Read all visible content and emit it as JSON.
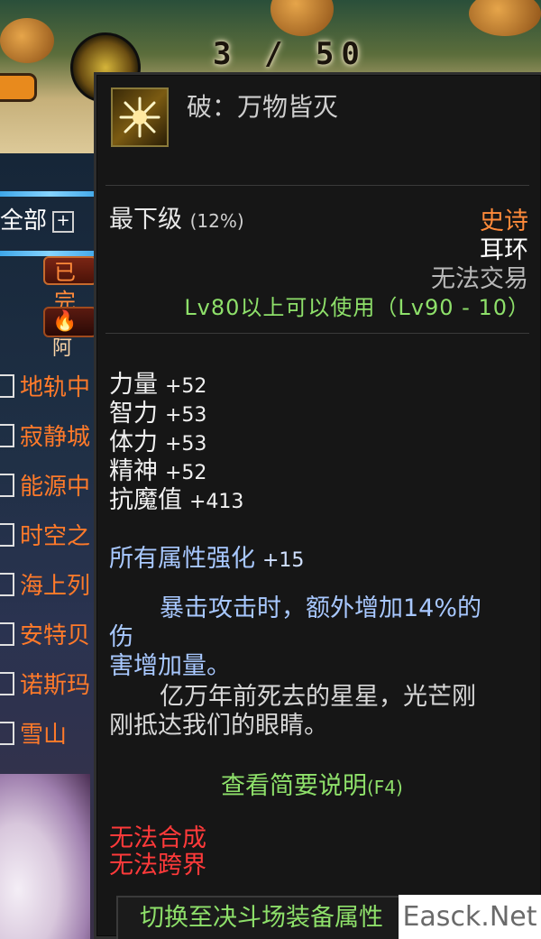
{
  "background": {
    "page_counter": "3 / 50",
    "filter_all": "全部",
    "filter_expand": "+",
    "tag_completed": "已完",
    "tag_other": "阿",
    "quest_list": [
      "地轨中",
      "寂静城",
      "能源中",
      "时空之",
      "海上列",
      "安特贝",
      "诺斯玛",
      "雪山"
    ]
  },
  "tooltip": {
    "item_name": "破：万物皆灭",
    "grade_label": "最下级",
    "grade_percent": "(12%)",
    "rarity": "史诗",
    "slot": "耳环",
    "trade": "无法交易",
    "level_requirement": "Lv80以上可以使用（Lv90 - 10）",
    "stats": [
      {
        "name": "力量",
        "value": "+52"
      },
      {
        "name": "智力",
        "value": "+53"
      },
      {
        "name": "体力",
        "value": "+53"
      },
      {
        "name": "精神",
        "value": "+52"
      },
      {
        "name": "抗魔值",
        "value": "+413"
      }
    ],
    "all_attribute": {
      "name": "所有属性强化",
      "value": "+15"
    },
    "effect_line1": "暴击攻击时，额外增加14%的伤",
    "effect_line2": "害增加量。",
    "lore_line1": "亿万年前死去的星星，光芒刚",
    "lore_line2": "刚抵达我们的眼睛。",
    "brief_label": "查看简要说明",
    "brief_key": "(F4)",
    "cannot_combine": "无法合成",
    "cannot_cross": "无法跨界",
    "switch_button": "切换至决斗场装备属性"
  },
  "watermark": "Easck.Net",
  "colors": {
    "tooltip_bg": "#161616",
    "rarity_epic": "#ff8a3a",
    "green_text": "#8ee06a",
    "blue_text": "#a8c8ff",
    "red_text": "#ff3a3a"
  }
}
